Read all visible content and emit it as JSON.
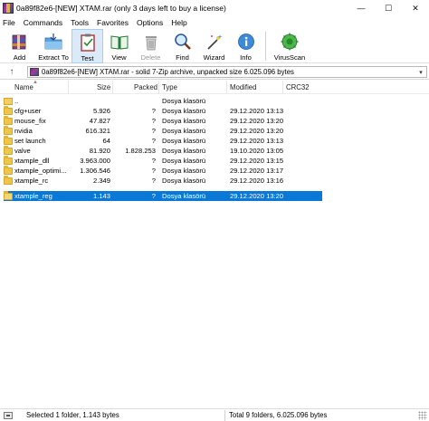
{
  "window": {
    "title": "0a89f82e6-[NEW] XTAM.rar (only 3 days left to buy a license)",
    "controls": {
      "minimize": "—",
      "maximize": "☐",
      "close": "✕"
    }
  },
  "menu": [
    "File",
    "Commands",
    "Tools",
    "Favorites",
    "Options",
    "Help"
  ],
  "toolbar": {
    "add": "Add",
    "extract_to": "Extract To",
    "test": "Test",
    "view": "View",
    "delete": "Delete",
    "find": "Find",
    "wizard": "Wizard",
    "info": "Info",
    "virusscan": "VirusScan"
  },
  "address": {
    "up_arrow": "↑",
    "path": "0a89f82e6-[NEW] XTAM.rar - solid 7-Zip archive, unpacked size 6.025.096 bytes",
    "dropdown": "▾"
  },
  "columns": {
    "name": "Name",
    "size": "Size",
    "packed": "Packed",
    "type": "Type",
    "modified": "Modified",
    "crc": "CRC32"
  },
  "files": [
    {
      "name": "..",
      "size": "",
      "packed": "",
      "type": "Dosya klasörü",
      "modified": ""
    },
    {
      "name": "cfg+user",
      "size": "5.926",
      "packed": "?",
      "type": "Dosya klasörü",
      "modified": "29.12.2020 13:13"
    },
    {
      "name": "mouse_fix",
      "size": "47.827",
      "packed": "?",
      "type": "Dosya klasörü",
      "modified": "29.12.2020 13:20"
    },
    {
      "name": "nvidia",
      "size": "616.321",
      "packed": "?",
      "type": "Dosya klasörü",
      "modified": "29.12.2020 13:20"
    },
    {
      "name": "set launch",
      "size": "64",
      "packed": "?",
      "type": "Dosya klasörü",
      "modified": "29.12.2020 13:13"
    },
    {
      "name": "valve",
      "size": "81.920",
      "packed": "1.828.253",
      "type": "Dosya klasörü",
      "modified": "19.10.2020 13:05"
    },
    {
      "name": "xtample_dll",
      "size": "3.963.000",
      "packed": "?",
      "type": "Dosya klasörü",
      "modified": "29.12.2020 13:15"
    },
    {
      "name": "xtample_optimi...",
      "size": "1.306.546",
      "packed": "?",
      "type": "Dosya klasörü",
      "modified": "29.12.2020 13:17"
    },
    {
      "name": "xtample_rc",
      "size": "2.349",
      "packed": "?",
      "type": "Dosya klasörü",
      "modified": "29.12.2020 13:16"
    },
    {
      "name": "xtample_reg",
      "size": "1.143",
      "packed": "?",
      "type": "Dosya klasörü",
      "modified": "29.12.2020 13:20",
      "selected": true
    }
  ],
  "status": {
    "left": "Selected 1 folder, 1.143 bytes",
    "right": "Total 9 folders, 6.025.096 bytes"
  },
  "colors": {
    "selection": "#0a78d7",
    "folder": "#f0c64a"
  }
}
